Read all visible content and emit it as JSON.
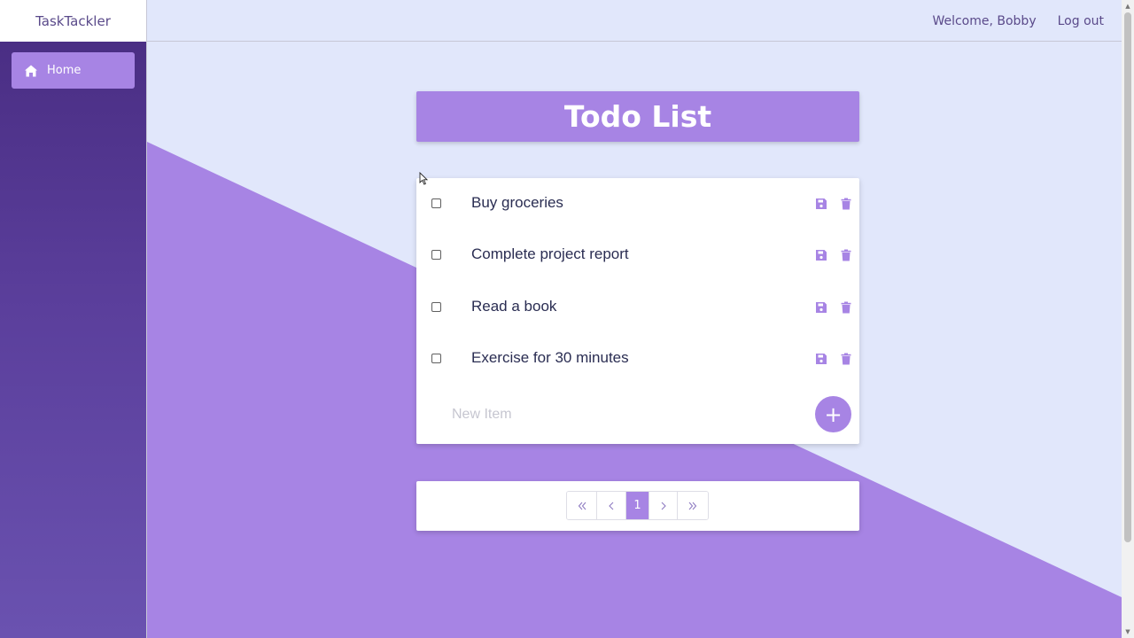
{
  "app": {
    "brand": "TaskTackler"
  },
  "header": {
    "welcome": "Welcome, Bobby",
    "logout_label": "Log out"
  },
  "sidebar": {
    "items": [
      {
        "label": "Home",
        "icon": "home-icon",
        "active": true
      }
    ]
  },
  "main": {
    "title": "Todo List",
    "tasks": [
      {
        "text": "Buy groceries",
        "checked": false
      },
      {
        "text": "Complete project report",
        "checked": false
      },
      {
        "text": "Read a book",
        "checked": false
      },
      {
        "text": "Exercise for 30 minutes",
        "checked": false
      }
    ],
    "new_item_placeholder": "New Item",
    "add_label": "+"
  },
  "pagination": {
    "current_page": "1"
  },
  "colors": {
    "accent": "#a784e4",
    "background": "#e1e7fb",
    "sidebar_top": "#4a2e84",
    "sidebar_bottom": "#6a52b0",
    "text_dark": "#2a2d52"
  }
}
